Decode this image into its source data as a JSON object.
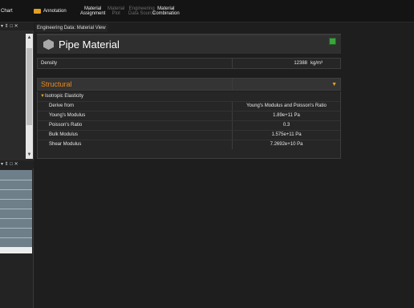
{
  "toolbar": {
    "chart_label": "Chart",
    "annotation_label": "Annotation",
    "material_assignment": [
      "Material",
      "Assignment"
    ],
    "material_plot": [
      "Material",
      "Plot"
    ],
    "engineering_data_source": [
      "Engineering",
      "Data Source"
    ],
    "material_combination": [
      "Material",
      "Combination"
    ]
  },
  "left_top_pane": {
    "header_glyphs": "▾ ⇕ □ ✕"
  },
  "left_bottom_pane": {
    "header_glyphs": "▾ ⇕ □ ✕"
  },
  "document_tab": "Engineering Data: Material View",
  "material": {
    "name": "Pipe Material",
    "density": {
      "label": "Density",
      "value": "12388",
      "unit": "kg/m³"
    }
  },
  "structural": {
    "label": "Structural",
    "group": {
      "label": "Isotropic Elasticity",
      "rows": [
        {
          "label": "Derive from",
          "value": "Young's Modulus and Poisson's Ratio"
        },
        {
          "label": "Young's Modulus",
          "value": "1.89e+11  Pa"
        },
        {
          "label": "Poisson's Ratio",
          "value": "0.3"
        },
        {
          "label": "Bulk Modulus",
          "value": "1.575e+11  Pa"
        },
        {
          "label": "Shear Modulus",
          "value": "7.2692e+10  Pa"
        }
      ]
    }
  },
  "icons": {
    "section_expand": "chevron-down-icon",
    "group_expand": "chevron-down-icon",
    "material": "cube-icon"
  },
  "colors": {
    "accent": "#e88a1a",
    "panel": "#262626",
    "background": "#1e1e1e"
  }
}
